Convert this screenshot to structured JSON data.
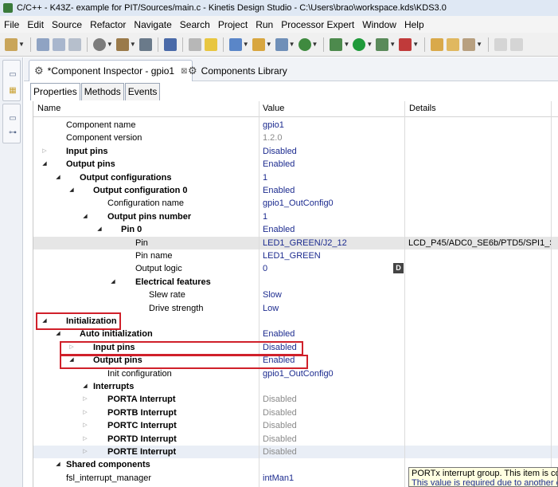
{
  "window": {
    "title": "C/C++ - K43Z- example for PIT/Sources/main.c - Kinetis Design Studio - C:\\Users\\brao\\workspace.kds\\KDS3.0"
  },
  "menubar": [
    "File",
    "Edit",
    "Source",
    "Refactor",
    "Navigate",
    "Search",
    "Project",
    "Run",
    "Processor Expert",
    "Window",
    "Help"
  ],
  "tabs": {
    "component_inspector": "*Component Inspector - gpio1",
    "components_library": "Components Library",
    "close_glyph": "⊠"
  },
  "subtabs": [
    "Properties",
    "Methods",
    "Events"
  ],
  "columns": {
    "name": "Name",
    "value": "Value",
    "details": "Details"
  },
  "rows": [
    {
      "name": "Component name",
      "value": "gpio1",
      "details": ""
    },
    {
      "name": "Component version",
      "value": "1.2.0",
      "details": ""
    },
    {
      "name": "Input pins",
      "value": "Disabled",
      "details": ""
    },
    {
      "name": "Output pins",
      "value": "Enabled",
      "details": ""
    },
    {
      "name": "Output configurations",
      "value": "1",
      "details": ""
    },
    {
      "name": "Output configuration 0",
      "value": "Enabled",
      "details": ""
    },
    {
      "name": "Configuration name",
      "value": "gpio1_OutConfig0",
      "details": ""
    },
    {
      "name": "Output pins number",
      "value": "1",
      "details": ""
    },
    {
      "name": "Pin 0",
      "value": "Enabled",
      "details": ""
    },
    {
      "name": "Pin",
      "value": "LED1_GREEN/J2_12",
      "details": "LCD_P45/ADC0_SE6b/PTD5/SPI1_S..."
    },
    {
      "name": "Pin name",
      "value": "LED1_GREEN",
      "details": ""
    },
    {
      "name": "Output logic",
      "value": "0",
      "details": "",
      "button": "D"
    },
    {
      "name": "Electrical features",
      "value": "",
      "details": ""
    },
    {
      "name": "Slew rate",
      "value": "Slow",
      "details": ""
    },
    {
      "name": "Drive strength",
      "value": "Low",
      "details": ""
    },
    {
      "name": "Initialization",
      "value": "",
      "details": ""
    },
    {
      "name": "Auto initialization",
      "value": "Enabled",
      "details": ""
    },
    {
      "name": "Input pins",
      "value": "Disabled",
      "details": ""
    },
    {
      "name": "Output pins",
      "value": "Enabled",
      "details": ""
    },
    {
      "name": "Init configuration",
      "value": "gpio1_OutConfig0",
      "details": ""
    },
    {
      "name": "Interrupts",
      "value": "",
      "details": ""
    },
    {
      "name": "PORTA Interrupt",
      "value": "Disabled",
      "details": ""
    },
    {
      "name": "PORTB Interrupt",
      "value": "Disabled",
      "details": ""
    },
    {
      "name": "PORTC Interrupt",
      "value": "Disabled",
      "details": ""
    },
    {
      "name": "PORTD Interrupt",
      "value": "Disabled",
      "details": ""
    },
    {
      "name": "PORTE Interrupt",
      "value": "Disabled",
      "details": ""
    },
    {
      "name": "Shared components",
      "value": "",
      "details": ""
    },
    {
      "name": "fsl_interrupt_manager",
      "value": "intMan1",
      "details": ""
    }
  ],
  "tooltip": {
    "line1": "PORTx interrupt group. This item is co",
    "line2": "This value is required due to another c"
  },
  "colors": {
    "highlight_box": "#d0202a",
    "value_text": "#1c2b8f",
    "disabled_text": "#8a8a8a"
  }
}
